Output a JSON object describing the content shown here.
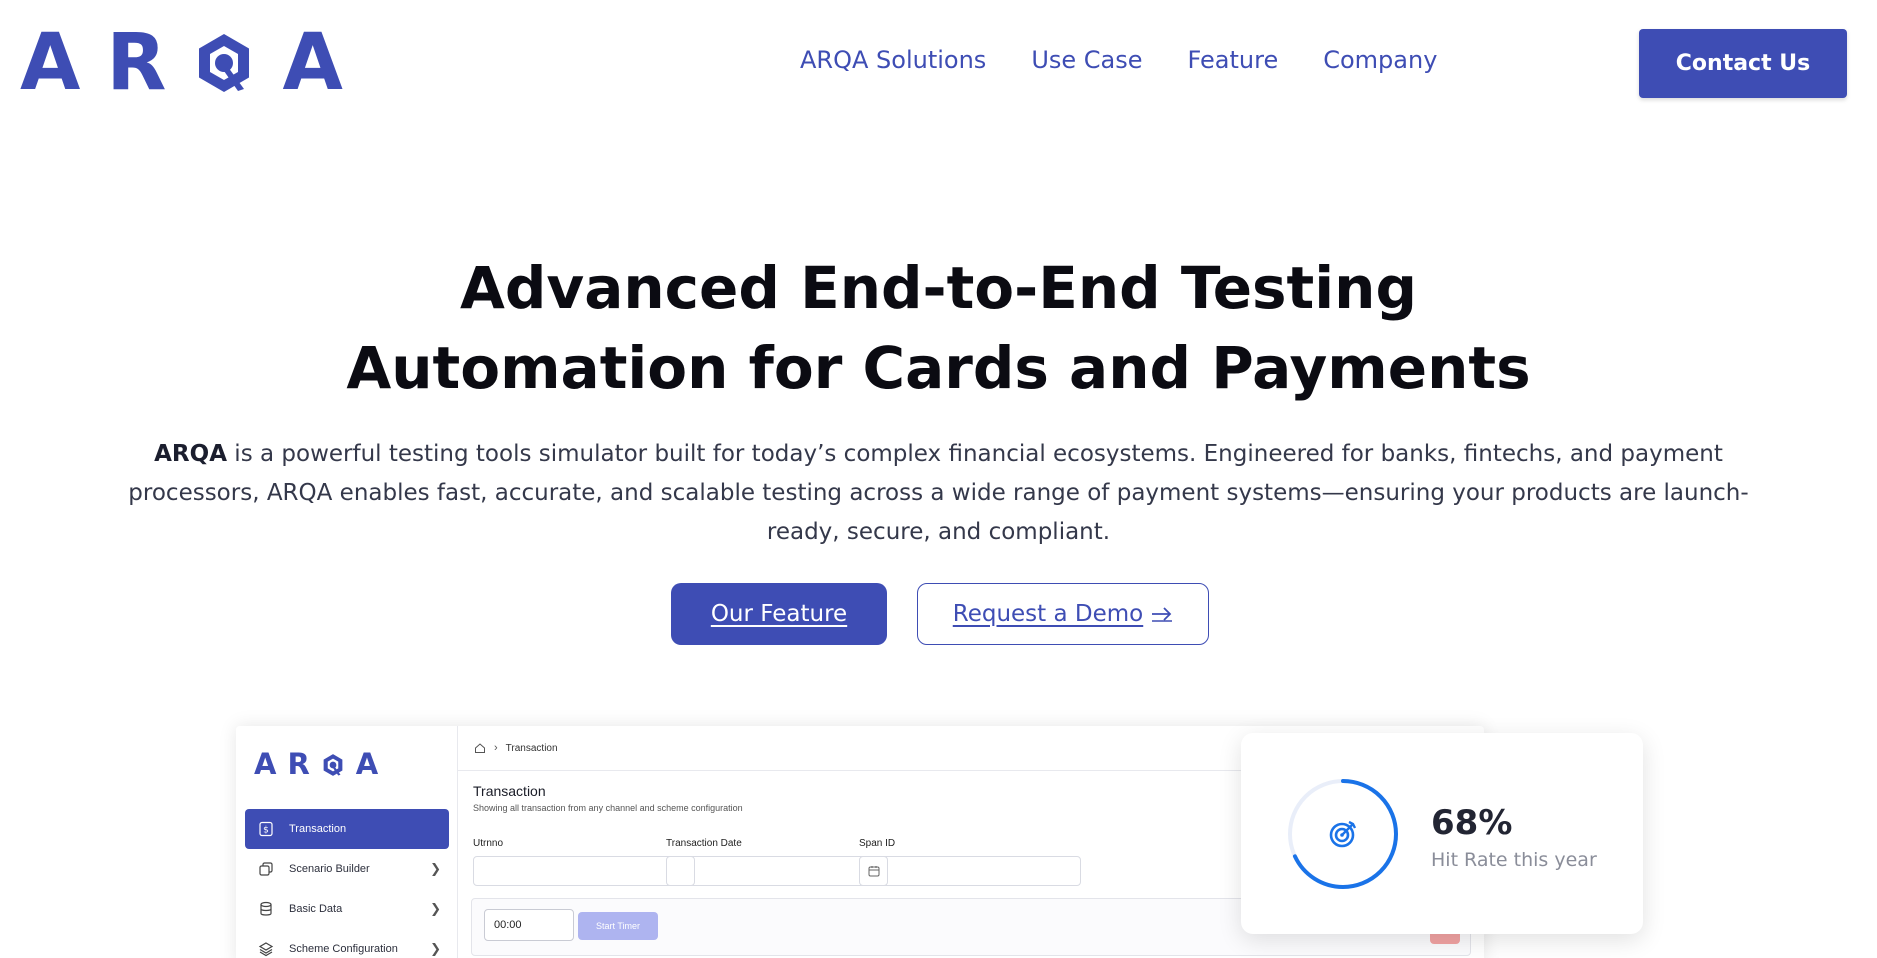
{
  "brand": {
    "name": "ARQA",
    "letters": [
      "A",
      "R",
      "Q",
      "A"
    ],
    "color": "#3e4db4"
  },
  "nav": {
    "links": [
      "ARQA Solutions",
      "Use Case",
      "Feature",
      "Company"
    ],
    "contact_label": "Contact Us"
  },
  "hero": {
    "title_line1": "Advanced End-to-End Testing",
    "title_line2": "Automation for Cards and Payments",
    "desc_brand": "ARQA",
    "desc_rest": " is a powerful testing tools simulator built for today’s complex financial ecosystems. Engineered for banks,  fintechs, and payment processors, ARQA enables fast, accurate, and scalable testing across a wide range of payment systems—ensuring your products are launch-ready, secure, and compliant.",
    "primary_button": "Our Feature",
    "secondary_button": "Request a Demo",
    "secondary_icon": "arrow-right-icon"
  },
  "preview": {
    "sidebar": {
      "items": [
        {
          "label": "Transaction",
          "icon": "dollar-doc-icon",
          "active": true,
          "has_chevron": false
        },
        {
          "label": "Scenario Builder",
          "icon": "copy-icon",
          "active": false,
          "has_chevron": true
        },
        {
          "label": "Basic Data",
          "icon": "database-icon",
          "active": false,
          "has_chevron": true
        },
        {
          "label": "Scheme Configuration",
          "icon": "layers-icon",
          "active": false,
          "has_chevron": true
        }
      ]
    },
    "breadcrumb": {
      "icon": "home-icon",
      "current": "Transaction"
    },
    "page_title": "Transaction",
    "page_subtitle": "Showing all transaction from any channel and scheme configuration",
    "fields": [
      {
        "label": "Utrnno",
        "value": ""
      },
      {
        "label": "Transaction Date",
        "value": "",
        "icon": "calendar-icon"
      },
      {
        "label": "Span ID",
        "value": ""
      }
    ],
    "timer": {
      "value": "00:00",
      "start_label": "Start Timer"
    }
  },
  "stat": {
    "value": "68%",
    "label": "Hit Rate this year",
    "progress": 0.68,
    "icon": "target-icon",
    "accent": "#1a73e8"
  }
}
